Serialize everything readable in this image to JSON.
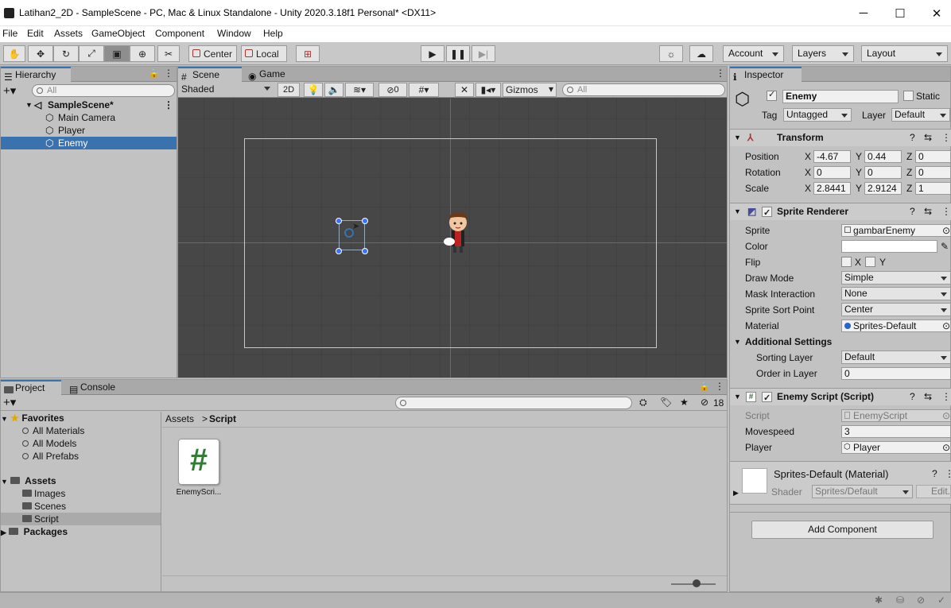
{
  "window": {
    "title": "Latihan2_2D - SampleScene - PC, Mac & Linux Standalone - Unity 2020.3.18f1 Personal* <DX11>",
    "min": "─",
    "max": "☐",
    "close": "✕"
  },
  "menu": [
    "File",
    "Edit",
    "Assets",
    "GameObject",
    "Component",
    "Window",
    "Help"
  ],
  "toolbar": {
    "pivot_center": "Center",
    "pivot_local": "Local",
    "account": "Account",
    "layers": "Layers",
    "layout": "Layout"
  },
  "hierarchy": {
    "tab": "Hierarchy",
    "search_placeholder": "All",
    "scene": "SampleScene*",
    "items": [
      "Main Camera",
      "Player",
      "Enemy"
    ]
  },
  "scene": {
    "tab_scene": "Scene",
    "tab_game": "Game",
    "shading": "Shaded",
    "mode_2d": "2D",
    "hidden_count": "0",
    "gizmos": "Gizmos",
    "search_placeholder": "All"
  },
  "inspector": {
    "tab": "Inspector",
    "object_name": "Enemy",
    "static_label": "Static",
    "tag_label": "Tag",
    "tag_value": "Untagged",
    "layer_label": "Layer",
    "layer_value": "Default",
    "transform": {
      "title": "Transform",
      "position_label": "Position",
      "pos_x": "-4.67",
      "pos_y": "0.44",
      "pos_z": "0",
      "rotation_label": "Rotation",
      "rot_x": "0",
      "rot_y": "0",
      "rot_z": "0",
      "scale_label": "Scale",
      "scale_x": "2.8441",
      "scale_y": "2.9124",
      "scale_z": "1",
      "x": "X",
      "y": "Y",
      "z": "Z"
    },
    "sprite_renderer": {
      "title": "Sprite Renderer",
      "sprite_label": "Sprite",
      "sprite_value": "gambarEnemy",
      "color_label": "Color",
      "flip_label": "Flip",
      "flip_x": "X",
      "flip_y": "Y",
      "draw_mode_label": "Draw Mode",
      "draw_mode_value": "Simple",
      "mask_label": "Mask Interaction",
      "mask_value": "None",
      "sort_point_label": "Sprite Sort Point",
      "sort_point_value": "Center",
      "material_label": "Material",
      "material_value": "Sprites-Default",
      "additional": "Additional Settings",
      "sorting_layer_label": "Sorting Layer",
      "sorting_layer_value": "Default",
      "order_label": "Order in Layer",
      "order_value": "0"
    },
    "enemy_script": {
      "title": "Enemy Script (Script)",
      "script_label": "Script",
      "script_value": "EnemyScript",
      "movespeed_label": "Movespeed",
      "movespeed_value": "3",
      "player_label": "Player",
      "player_value": "Player"
    },
    "material": {
      "title": "Sprites-Default (Material)",
      "shader_label": "Shader",
      "shader_value": "Sprites/Default",
      "edit": "Edit..."
    },
    "add_component": "Add Component"
  },
  "project": {
    "tab_project": "Project",
    "tab_console": "Console",
    "hidden_count": "18",
    "favorites": "Favorites",
    "fav_items": [
      "All Materials",
      "All Models",
      "All Prefabs"
    ],
    "assets": "Assets",
    "asset_folders": [
      "Images",
      "Scenes",
      "Script"
    ],
    "packages": "Packages",
    "breadcrumb_root": "Assets",
    "breadcrumb_sep": ">",
    "breadcrumb_current": "Script",
    "file_name": "EnemyScri...",
    "file_glyph": "#"
  },
  "colors": {
    "selection": "#3a72b0",
    "script_green": "#2e7d32"
  }
}
